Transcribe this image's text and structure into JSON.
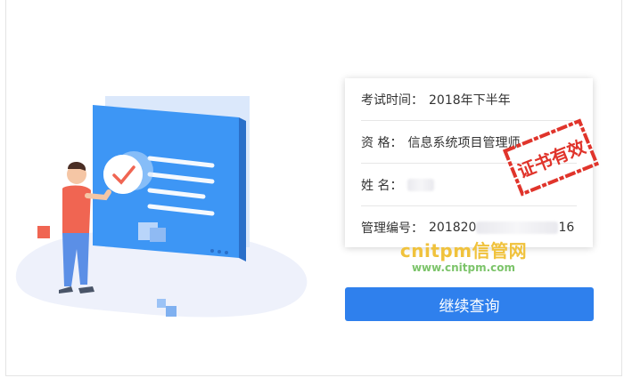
{
  "info_card": {
    "rows": [
      {
        "label": "考试时间：",
        "value": "2018年下半年"
      },
      {
        "label": "资 格：",
        "value": "信息系统项目管理师"
      },
      {
        "label": "姓 名：",
        "value": ""
      },
      {
        "label": "管理编号：",
        "value_prefix": "201820",
        "value_suffix": "16"
      }
    ]
  },
  "stamp": {
    "text": "证书有效",
    "color": "#e0342b"
  },
  "watermark": {
    "brand": "cnitpm信管网",
    "url": "www.cnitpm.com"
  },
  "actions": {
    "continue_label": "继续查询"
  },
  "colors": {
    "primary": "#2f80ed",
    "screen": "#3d96f5",
    "accent_red": "#f06552"
  }
}
